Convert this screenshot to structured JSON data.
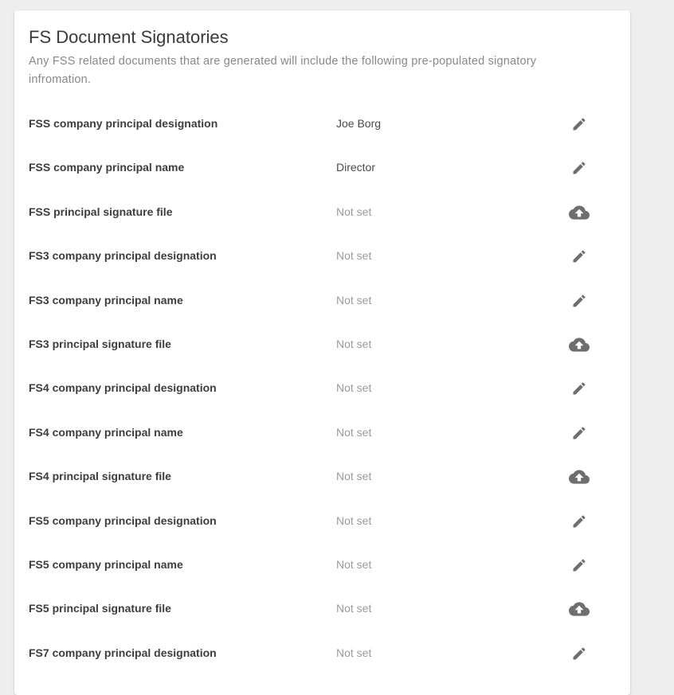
{
  "card": {
    "title": "FS Document Signatories",
    "subtitle": "Any FSS related documents that are generated will include the following pre-populated signatory infromation."
  },
  "colors": {
    "icon": "#6e6e6e",
    "label": "#3d3d3d",
    "value": "#4a4a4a",
    "unset": "#9a9a9a"
  },
  "rows": [
    {
      "label": "FSS company principal designation",
      "value": "Joe Borg",
      "set": true,
      "action_icon": "pencil-icon"
    },
    {
      "label": "FSS company principal name",
      "value": "Director",
      "set": true,
      "action_icon": "pencil-icon"
    },
    {
      "label": "FSS principal signature file",
      "value": "Not set",
      "set": false,
      "action_icon": "cloud-upload-icon"
    },
    {
      "label": "FS3 company principal designation",
      "value": "Not set",
      "set": false,
      "action_icon": "pencil-icon"
    },
    {
      "label": "FS3 company principal name",
      "value": "Not set",
      "set": false,
      "action_icon": "pencil-icon"
    },
    {
      "label": "FS3 principal signature file",
      "value": "Not set",
      "set": false,
      "action_icon": "cloud-upload-icon"
    },
    {
      "label": "FS4 company principal designation",
      "value": "Not set",
      "set": false,
      "action_icon": "pencil-icon"
    },
    {
      "label": "FS4 company principal name",
      "value": "Not set",
      "set": false,
      "action_icon": "pencil-icon"
    },
    {
      "label": "FS4 principal signature file",
      "value": "Not set",
      "set": false,
      "action_icon": "cloud-upload-icon"
    },
    {
      "label": "FS5 company principal designation",
      "value": "Not set",
      "set": false,
      "action_icon": "pencil-icon"
    },
    {
      "label": "FS5 company principal name",
      "value": "Not set",
      "set": false,
      "action_icon": "pencil-icon"
    },
    {
      "label": "FS5 principal signature file",
      "value": "Not set",
      "set": false,
      "action_icon": "cloud-upload-icon"
    },
    {
      "label": "FS7 company principal designation",
      "value": "Not set",
      "set": false,
      "action_icon": "pencil-icon"
    }
  ]
}
